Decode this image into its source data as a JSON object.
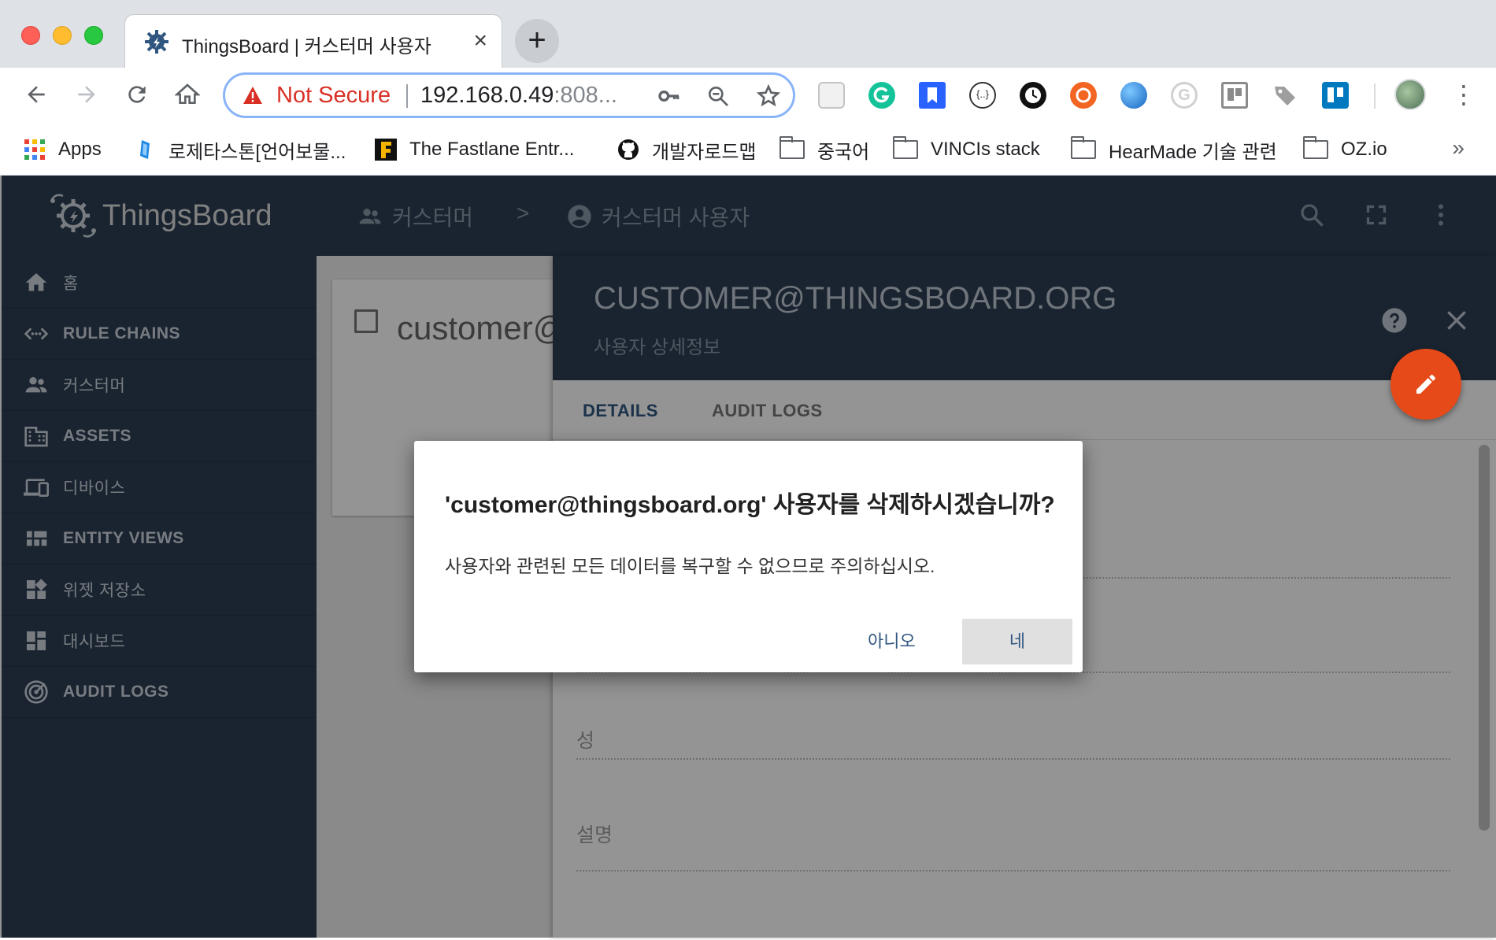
{
  "browser": {
    "tab_title": "ThingsBoard | 커스터머 사용자",
    "tab_close": "×",
    "new_tab": "+",
    "security_label": "Not Secure",
    "url_host": "192.168.0.49",
    "url_port": ":808...",
    "bookmarks": [
      {
        "label": "Apps",
        "icon": "apps-grid-icon"
      },
      {
        "label": "로제타스톤[언어보물...",
        "icon": "rosetta-icon"
      },
      {
        "label": "The Fastlane Entr...",
        "icon": "fastlane-icon"
      },
      {
        "label": "개발자로드맵",
        "icon": "github-icon"
      },
      {
        "label": "중국어",
        "icon": "folder-icon"
      },
      {
        "label": "VINCIs stack",
        "icon": "folder-icon"
      },
      {
        "label": "HearMade 기술 관련",
        "icon": "folder-icon"
      },
      {
        "label": "OZ.io",
        "icon": "folder-icon"
      }
    ],
    "bookmarks_more": "»"
  },
  "app": {
    "logo_text": "ThingsBoard",
    "menu": [
      {
        "label": "홈",
        "icon": "home-icon"
      },
      {
        "label": "RULE CHAINS",
        "icon": "rule-chains-icon"
      },
      {
        "label": "커스터머",
        "icon": "customers-icon"
      },
      {
        "label": "ASSETS",
        "icon": "assets-icon"
      },
      {
        "label": "디바이스",
        "icon": "devices-icon"
      },
      {
        "label": "ENTITY VIEWS",
        "icon": "entity-views-icon"
      },
      {
        "label": "위젯 저장소",
        "icon": "widgets-icon"
      },
      {
        "label": "대시보드",
        "icon": "dashboards-icon"
      },
      {
        "label": "AUDIT LOGS",
        "icon": "audit-logs-icon"
      }
    ],
    "breadcrumb": {
      "first": "커스터머",
      "separator": ">",
      "second": "커스터머 사용자"
    },
    "card_text": "customer@thingsboard.org",
    "panel": {
      "title": "CUSTOMER@THINGSBOARD.ORG",
      "subtitle": "사용자 상세정보",
      "tabs": [
        "DETAILS",
        "AUDIT LOGS"
      ],
      "fields": [
        "성",
        "설명"
      ]
    }
  },
  "dialog": {
    "title": "'customer@thingsboard.org' 사용자를 삭제하시겠습니까?",
    "body": "사용자와 관련된 모든 데이터를 복구할 수 없으므로 주의하십시오.",
    "cancel_label": "아니오",
    "confirm_label": "네"
  },
  "colors": {
    "primary_dark": "#2c3e54",
    "accent_fab": "#e64a19",
    "link_blue": "#305680",
    "warning_red": "#d93025"
  }
}
